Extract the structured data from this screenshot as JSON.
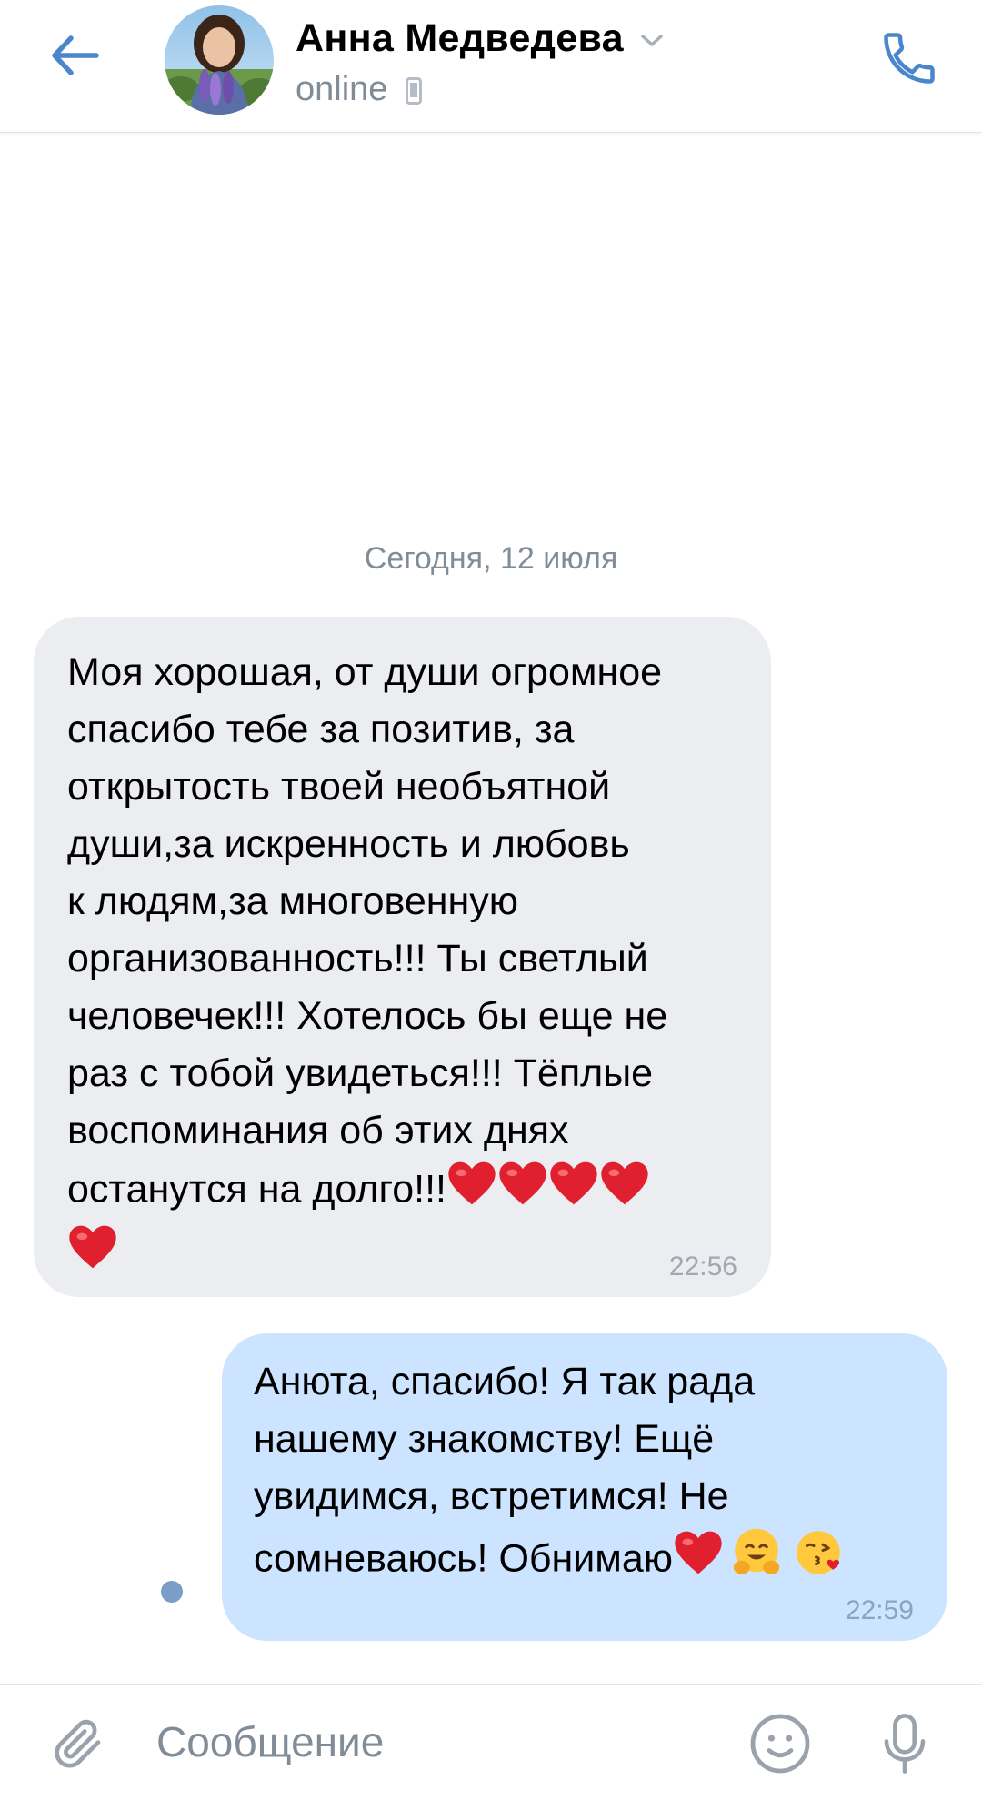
{
  "header": {
    "contact_name": "Анна Медведева",
    "status": "online",
    "icons": {
      "back": "arrow-left-icon",
      "chevron": "chevron-down-icon",
      "device": "mobile-phone-icon",
      "call": "phone-icon"
    }
  },
  "chat": {
    "date_separator": "Сегодня, 12 июля",
    "messages": [
      {
        "direction": "incoming",
        "text": "Моя хорошая, от души огромное\nспасибо тебе за позитив, за\nоткрытость твоей необъятной\nдуши,за искренность и любовь\nк людям,за многовенную\nорганизованность!!! Ты светлый\nчеловечек!!! Хотелось бы еще не\nраз с тобой увидеться!!! Тёплые\nвоспоминания об этих днях\nостанутся на долго!!!",
        "emojis": [
          "red-heart",
          "red-heart",
          "red-heart",
          "red-heart",
          "red-heart"
        ],
        "time": "22:56"
      },
      {
        "direction": "outgoing",
        "text": "Анюта, спасибо! Я так рада\nнашему знакомству! Ещё\nувидимся, встретимся! Не\nсомневаюсь! Обнимаю",
        "emojis": [
          "red-heart",
          "hugging-face",
          "face-blowing-kiss"
        ],
        "time": "22:59",
        "unread": true
      }
    ]
  },
  "composer": {
    "placeholder": "Сообщение",
    "icons": {
      "attach": "paperclip-icon",
      "emoji": "smiley-icon",
      "voice": "microphone-icon"
    }
  },
  "colors": {
    "accent": "#4986cc",
    "incoming_bubble": "#ebedf0",
    "outgoing_bubble": "#cce4ff",
    "secondary_text": "#818c99",
    "heart": "#e0202e",
    "unread_dot": "#7b9ec7"
  }
}
